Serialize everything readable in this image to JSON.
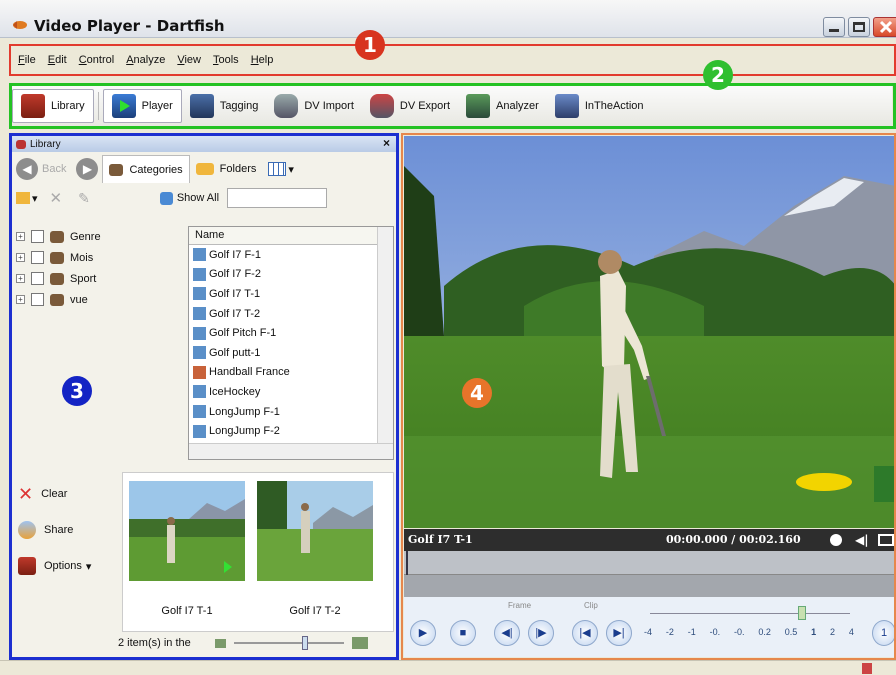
{
  "window": {
    "title": "Video Player - Dartfish"
  },
  "menu": [
    {
      "label": "File",
      "mnemonic": "F",
      "rest": "ile"
    },
    {
      "label": "Edit",
      "mnemonic": "E",
      "rest": "dit"
    },
    {
      "label": "Control",
      "mnemonic": "C",
      "rest": "ontrol"
    },
    {
      "label": "Analyze",
      "mnemonic": "A",
      "rest": "nalyze"
    },
    {
      "label": "View",
      "mnemonic": "V",
      "rest": "iew"
    },
    {
      "label": "Tools",
      "mnemonic": "T",
      "rest": "ools"
    },
    {
      "label": "Help",
      "mnemonic": "H",
      "rest": "elp"
    }
  ],
  "toolbar": {
    "library": "Library",
    "player": "Player",
    "tagging": "Tagging",
    "dv_import": "DV Import",
    "dv_export": "DV Export",
    "analyzer": "Analyzer",
    "intheaction": "InTheAction"
  },
  "library": {
    "header": "Library",
    "back": "Back",
    "tab_categories": "Categories",
    "tab_folders": "Folders",
    "show_all": "Show All",
    "tree": [
      "Genre",
      "Mois",
      "Sport",
      "vue"
    ],
    "list_header": "Name",
    "files": [
      "Golf I7 F-1",
      "Golf I7 F-2",
      "Golf I7 T-1",
      "Golf I7 T-2",
      "Golf Pitch F-1",
      "Golf putt-1",
      "Handball France",
      "IceHockey",
      "LongJump F-1",
      "LongJump F-2"
    ],
    "actions": {
      "clear": "Clear",
      "share": "Share",
      "options": "Options"
    },
    "thumbnails": [
      "Golf I7 T-1",
      "Golf I7 T-2"
    ],
    "status": "2 item(s) in the"
  },
  "player": {
    "clip_name": "Golf I7 T-1",
    "time": "00:00.000 / 00:02.160",
    "frame_label": "Frame",
    "clip_label": "Clip",
    "speed_ticks": [
      "-4",
      "-2",
      "-1",
      "-0.",
      "-0.",
      "0.2",
      "0.5",
      "1",
      "2",
      "4"
    ],
    "speed_value": "1"
  },
  "callouts": [
    "1",
    "2",
    "3",
    "4"
  ],
  "colors": {
    "callout_menu": "#e23b2e",
    "callout_toolbar": "#24c224",
    "callout_library": "#1c2fd0",
    "callout_player": "#e6874c"
  }
}
